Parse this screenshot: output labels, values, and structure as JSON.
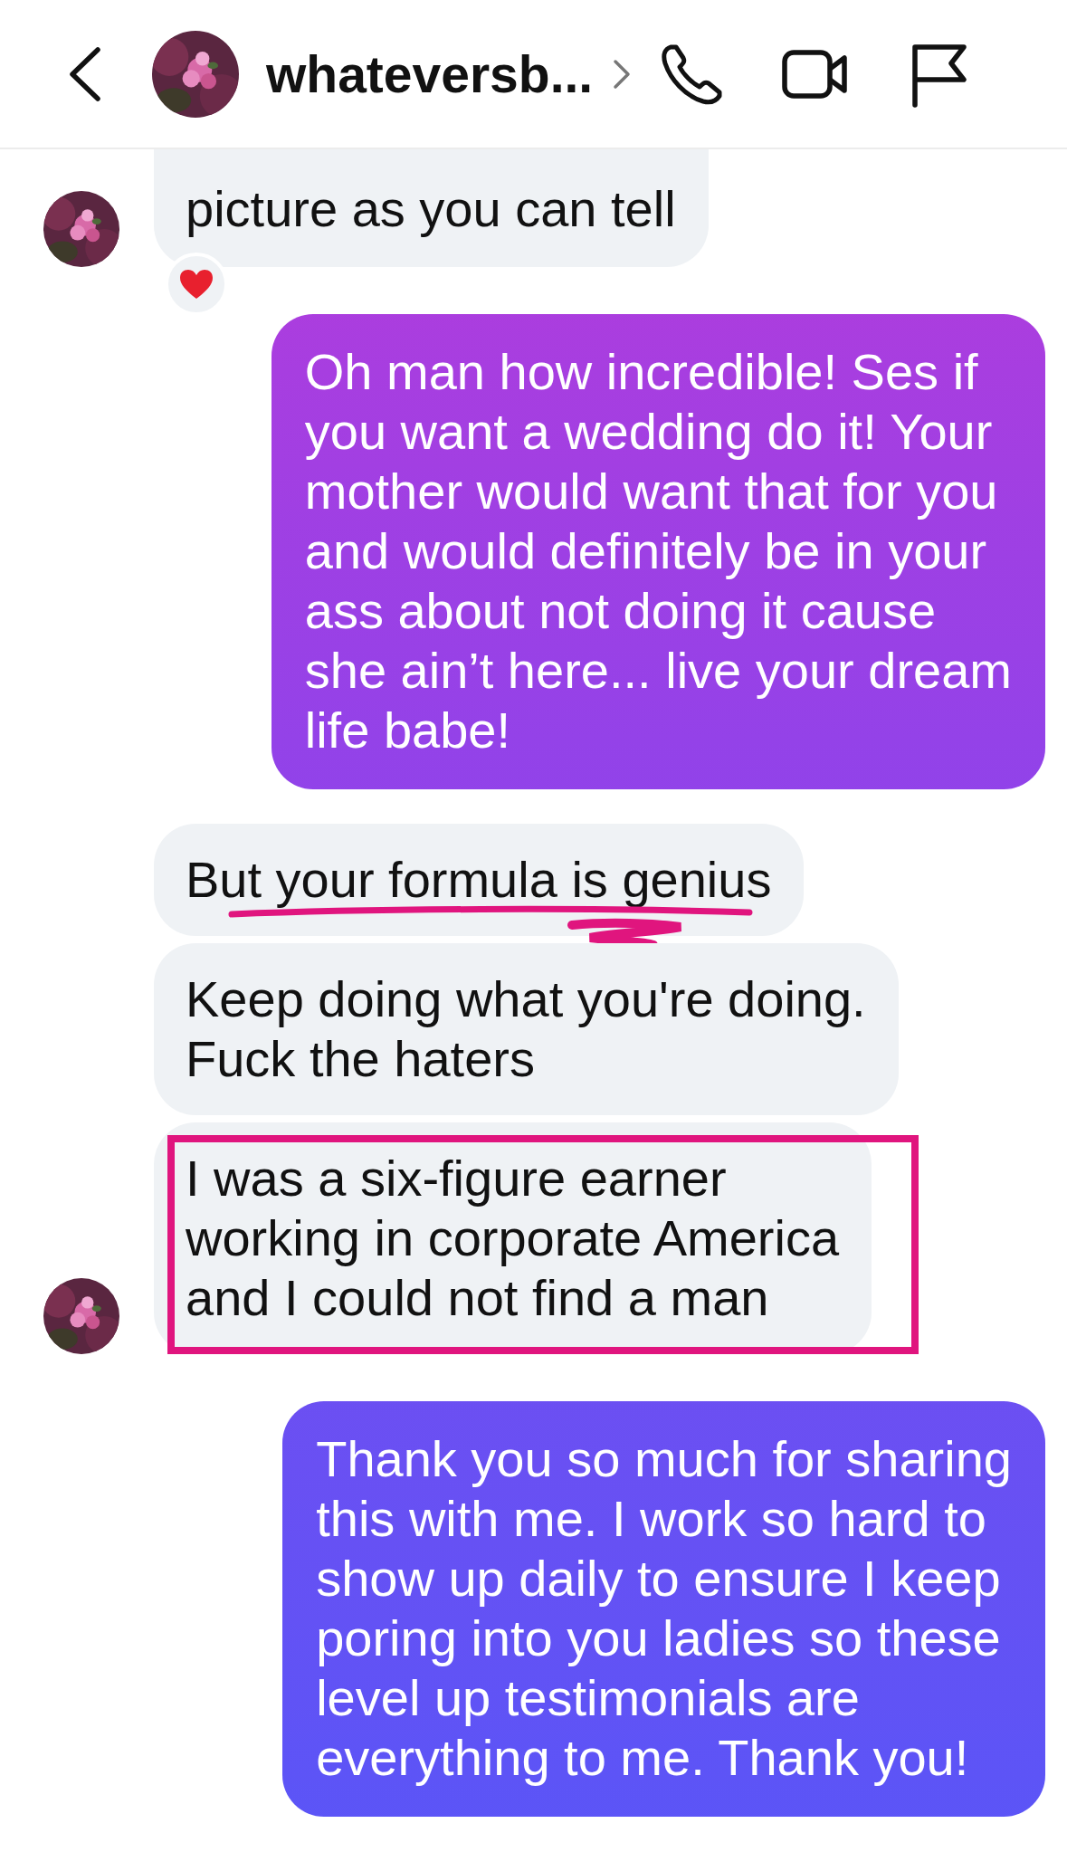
{
  "header": {
    "title": "whateversb..."
  },
  "messages": [
    {
      "kind": "received",
      "text": "picture as you can tell",
      "avatar": true,
      "reacted": true,
      "underlined": false,
      "boxed": false
    },
    {
      "kind": "sent",
      "text": "Oh man how incredible! Ses if\nyou want a wedding do it! Your\nmother would want that for you\nand would definitely be in your\nass about not doing it cause\nshe ain’t here... live your dream\nlife babe!"
    },
    {
      "kind": "received",
      "text": "But your formula is genius",
      "avatar": false,
      "reacted": false,
      "underlined": true,
      "boxed": false
    },
    {
      "kind": "received",
      "text": "Keep doing what you're doing.\nFuck the haters",
      "avatar": false,
      "reacted": false,
      "underlined": false,
      "boxed": false
    },
    {
      "kind": "received",
      "text": "I was a six-figure earner\nworking in corporate America\nand I could not find a man",
      "avatar": true,
      "reacted": false,
      "underlined": false,
      "boxed": true
    },
    {
      "kind": "sent",
      "text": "Thank you so much for sharing\nthis with me. I work so hard to\nshow up daily to ensure I keep\nporing into you ladies so these\nlevel up testimonials are\neverything to me. Thank you!"
    }
  ]
}
